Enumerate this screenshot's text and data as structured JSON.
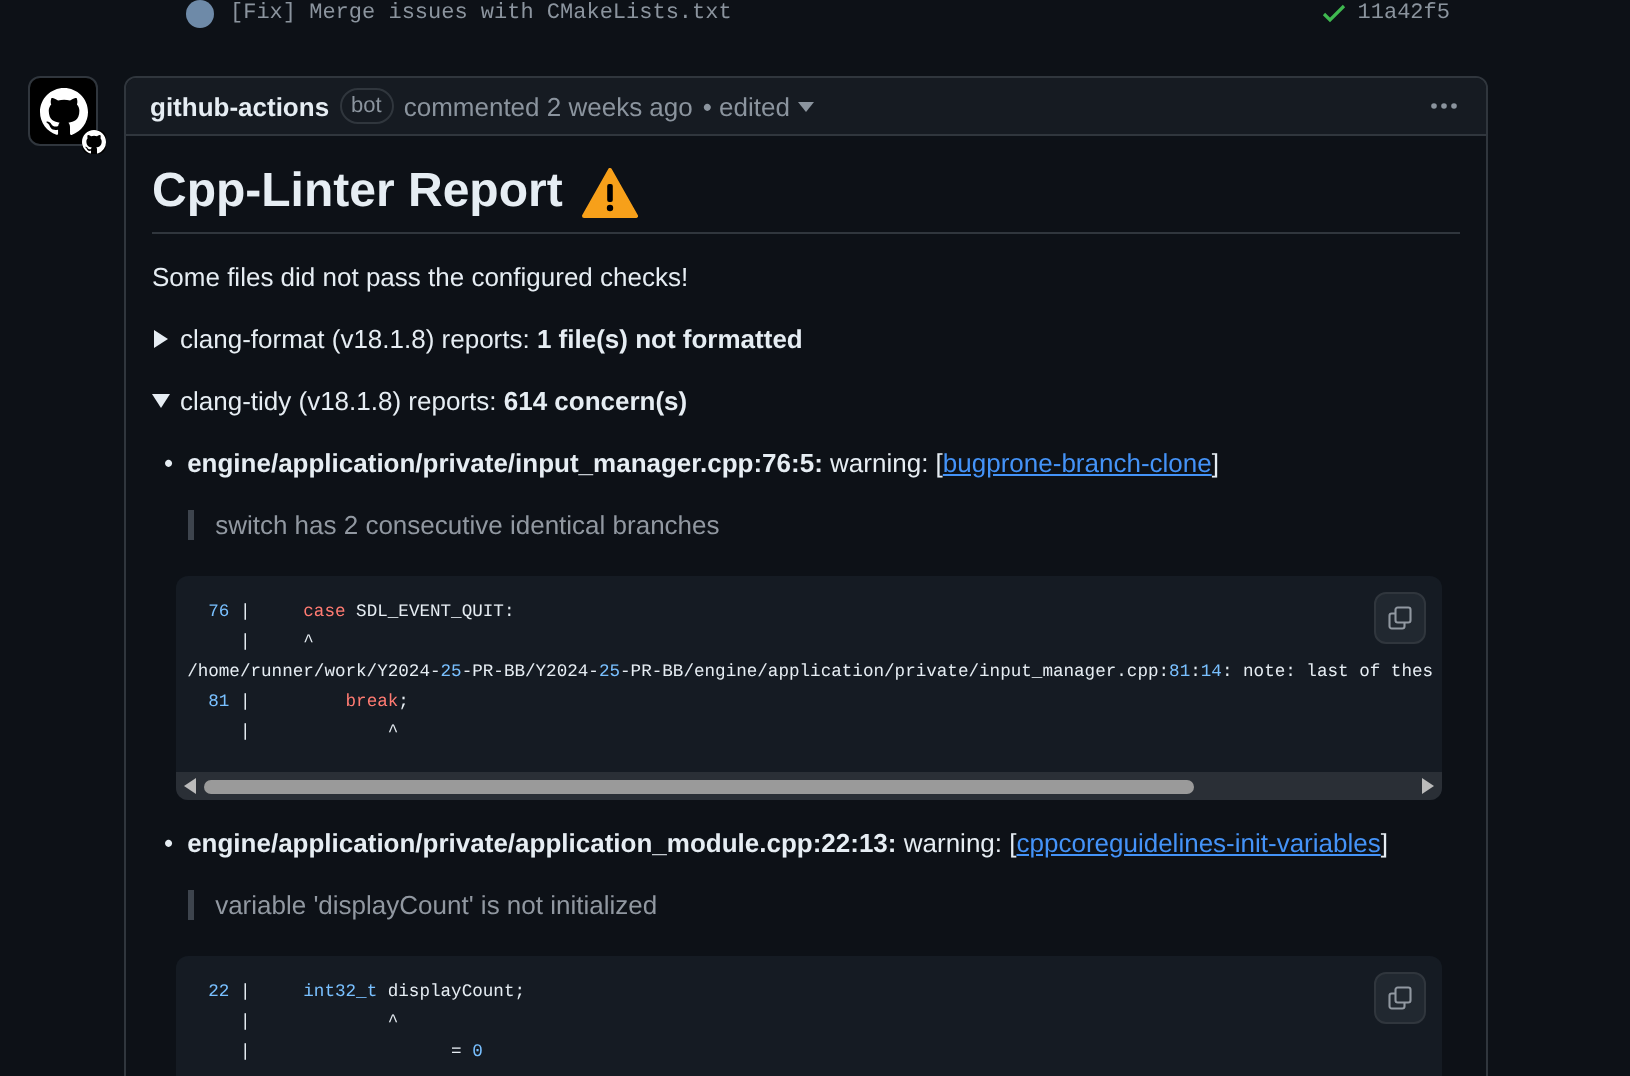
{
  "commit": {
    "message": "[Fix] Merge issues with CMakeLists.txt",
    "sha": "11a42f5"
  },
  "comment": {
    "author": "github-actions",
    "badge": "bot",
    "meta": "commented 2 weeks ago",
    "edited": "• edited"
  },
  "report": {
    "title": "Cpp-Linter Report",
    "intro": "Some files did not pass the configured checks!",
    "sections": [
      {
        "label": "clang-format (v18.1.8) reports: **1 file(s) not formatted**",
        "expanded": false
      },
      {
        "label": "clang-tidy (v18.1.8) reports: **614 concern(s)**",
        "expanded": true
      }
    ],
    "concerns": [
      {
        "bullet": "•",
        "location": "engine/application/private/input_manager.cpp:76:5:",
        "severity": "warning: [",
        "rule": "bugprone-branch-clone",
        "close": "]",
        "message": "switch has 2 consecutive identical branches",
        "scrollbar": true,
        "code": [
          [
            {
              "text": "  76",
              "kind": "number"
            },
            {
              "text": " |     ",
              "kind": "plain"
            },
            {
              "text": "case",
              "kind": "keyword"
            },
            {
              "text": " SDL_EVENT_QUIT:",
              "kind": "plain"
            }
          ],
          [
            {
              "text": "     |     ^",
              "kind": "plain"
            }
          ],
          [
            {
              "text": "/home/runner/work/Y2024-",
              "kind": "plain"
            },
            {
              "text": "25",
              "kind": "number"
            },
            {
              "text": "-PR-BB/Y2024-",
              "kind": "plain"
            },
            {
              "text": "25",
              "kind": "number"
            },
            {
              "text": "-PR-BB/engine/application/private/input_manager.cpp:",
              "kind": "plain"
            },
            {
              "text": "81",
              "kind": "number"
            },
            {
              "text": ":",
              "kind": "plain"
            },
            {
              "text": "14",
              "kind": "number"
            },
            {
              "text": ": note: last of thes",
              "kind": "plain"
            }
          ],
          [
            {
              "text": "  81",
              "kind": "number"
            },
            {
              "text": " |         ",
              "kind": "plain"
            },
            {
              "text": "break",
              "kind": "keyword"
            },
            {
              "text": ";",
              "kind": "plain"
            }
          ],
          [
            {
              "text": "     |             ^",
              "kind": "plain"
            }
          ]
        ]
      },
      {
        "bullet": "•",
        "location": "engine/application/private/application_module.cpp:22:13:",
        "severity": "warning: [",
        "rule": "cppcoreguidelines-init-variables",
        "close": "]",
        "message": "variable 'displayCount' is not initialized",
        "scrollbar": false,
        "code": [
          [
            {
              "text": "  22",
              "kind": "number"
            },
            {
              "text": " |     ",
              "kind": "plain"
            },
            {
              "text": "int32_t",
              "kind": "type"
            },
            {
              "text": " displayCount;",
              "kind": "plain"
            }
          ],
          [
            {
              "text": "     |             ^",
              "kind": "plain"
            }
          ],
          [
            {
              "text": "     |                   = ",
              "kind": "plain"
            },
            {
              "text": "0",
              "kind": "number"
            }
          ]
        ]
      }
    ]
  }
}
